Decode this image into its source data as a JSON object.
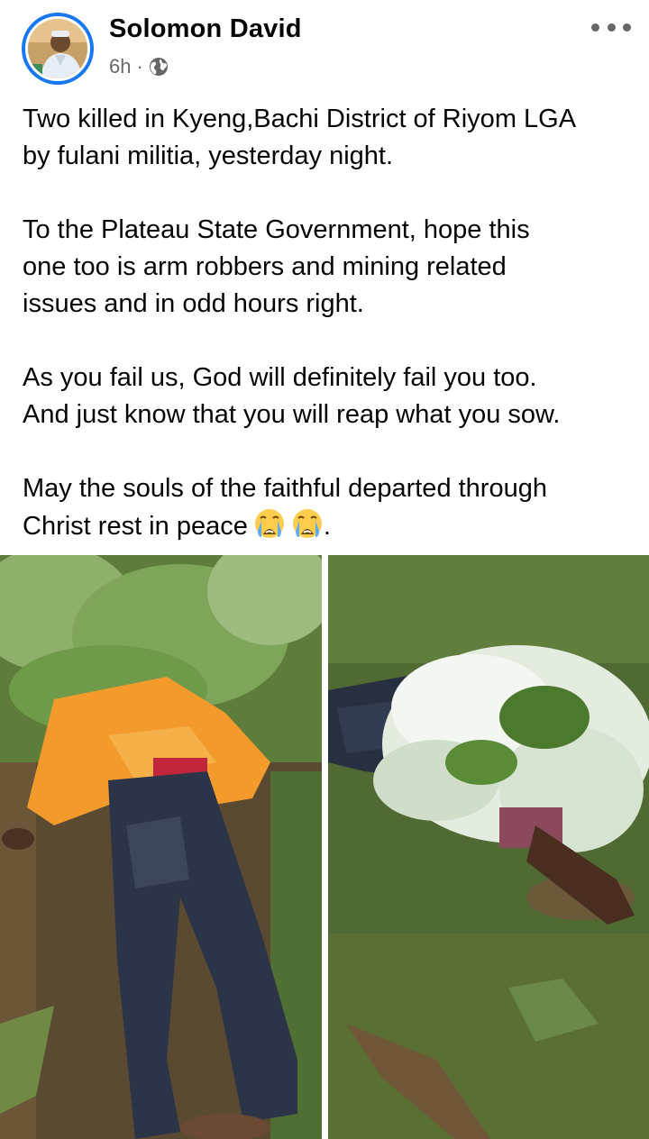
{
  "post": {
    "author": "Solomon David",
    "time": "6h",
    "separator": "·",
    "privacy_icon": "globe-icon",
    "menu_icon": "more-options-icon",
    "text": {
      "p1_line1": "Two killed in Kyeng,Bachi District of Riyom LGA",
      "p1_line2": "by fulani militia, yesterday night.",
      "p2_line1": "To the Plateau State Government, hope this",
      "p2_line2": "one too is arm robbers and mining related",
      "p2_line3": "issues and in odd hours right.",
      "p3_line1": "As you fail us, God will definitely fail you too.",
      "p3_line2": "And just know that you will reap what you sow.",
      "p4_line1": "May the souls of the faithful departed through",
      "p4_line2_text": "Christ rest in peace",
      "p4_line2_end": "."
    },
    "emoji_icon": "loudly-crying-face-icon",
    "photos": [
      {
        "name": "photo-left",
        "icon": "photo-icon"
      },
      {
        "name": "photo-right",
        "icon": "photo-icon"
      }
    ]
  },
  "colors": {
    "accent": "#1877f2",
    "text": "#050505",
    "secondary_text": "#65676b",
    "background": "#ffffff"
  }
}
